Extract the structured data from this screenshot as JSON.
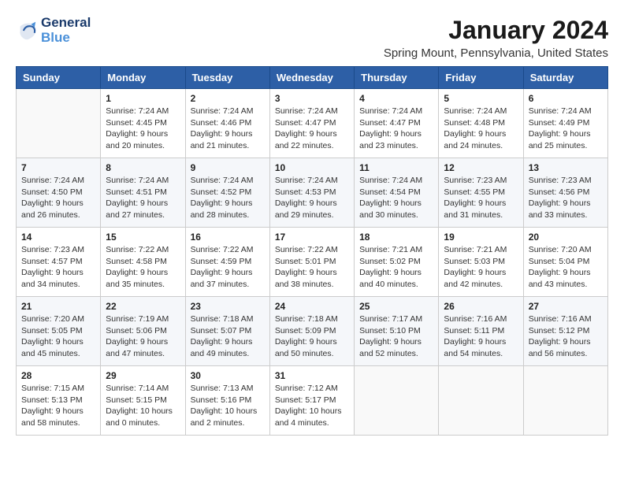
{
  "logo": {
    "line1": "General",
    "line2": "Blue"
  },
  "title": "January 2024",
  "location": "Spring Mount, Pennsylvania, United States",
  "days_of_week": [
    "Sunday",
    "Monday",
    "Tuesday",
    "Wednesday",
    "Thursday",
    "Friday",
    "Saturday"
  ],
  "weeks": [
    [
      {
        "day": "",
        "info": ""
      },
      {
        "day": "1",
        "info": "Sunrise: 7:24 AM\nSunset: 4:45 PM\nDaylight: 9 hours\nand 20 minutes."
      },
      {
        "day": "2",
        "info": "Sunrise: 7:24 AM\nSunset: 4:46 PM\nDaylight: 9 hours\nand 21 minutes."
      },
      {
        "day": "3",
        "info": "Sunrise: 7:24 AM\nSunset: 4:47 PM\nDaylight: 9 hours\nand 22 minutes."
      },
      {
        "day": "4",
        "info": "Sunrise: 7:24 AM\nSunset: 4:47 PM\nDaylight: 9 hours\nand 23 minutes."
      },
      {
        "day": "5",
        "info": "Sunrise: 7:24 AM\nSunset: 4:48 PM\nDaylight: 9 hours\nand 24 minutes."
      },
      {
        "day": "6",
        "info": "Sunrise: 7:24 AM\nSunset: 4:49 PM\nDaylight: 9 hours\nand 25 minutes."
      }
    ],
    [
      {
        "day": "7",
        "info": "Sunrise: 7:24 AM\nSunset: 4:50 PM\nDaylight: 9 hours\nand 26 minutes."
      },
      {
        "day": "8",
        "info": "Sunrise: 7:24 AM\nSunset: 4:51 PM\nDaylight: 9 hours\nand 27 minutes."
      },
      {
        "day": "9",
        "info": "Sunrise: 7:24 AM\nSunset: 4:52 PM\nDaylight: 9 hours\nand 28 minutes."
      },
      {
        "day": "10",
        "info": "Sunrise: 7:24 AM\nSunset: 4:53 PM\nDaylight: 9 hours\nand 29 minutes."
      },
      {
        "day": "11",
        "info": "Sunrise: 7:24 AM\nSunset: 4:54 PM\nDaylight: 9 hours\nand 30 minutes."
      },
      {
        "day": "12",
        "info": "Sunrise: 7:23 AM\nSunset: 4:55 PM\nDaylight: 9 hours\nand 31 minutes."
      },
      {
        "day": "13",
        "info": "Sunrise: 7:23 AM\nSunset: 4:56 PM\nDaylight: 9 hours\nand 33 minutes."
      }
    ],
    [
      {
        "day": "14",
        "info": "Sunrise: 7:23 AM\nSunset: 4:57 PM\nDaylight: 9 hours\nand 34 minutes."
      },
      {
        "day": "15",
        "info": "Sunrise: 7:22 AM\nSunset: 4:58 PM\nDaylight: 9 hours\nand 35 minutes."
      },
      {
        "day": "16",
        "info": "Sunrise: 7:22 AM\nSunset: 4:59 PM\nDaylight: 9 hours\nand 37 minutes."
      },
      {
        "day": "17",
        "info": "Sunrise: 7:22 AM\nSunset: 5:01 PM\nDaylight: 9 hours\nand 38 minutes."
      },
      {
        "day": "18",
        "info": "Sunrise: 7:21 AM\nSunset: 5:02 PM\nDaylight: 9 hours\nand 40 minutes."
      },
      {
        "day": "19",
        "info": "Sunrise: 7:21 AM\nSunset: 5:03 PM\nDaylight: 9 hours\nand 42 minutes."
      },
      {
        "day": "20",
        "info": "Sunrise: 7:20 AM\nSunset: 5:04 PM\nDaylight: 9 hours\nand 43 minutes."
      }
    ],
    [
      {
        "day": "21",
        "info": "Sunrise: 7:20 AM\nSunset: 5:05 PM\nDaylight: 9 hours\nand 45 minutes."
      },
      {
        "day": "22",
        "info": "Sunrise: 7:19 AM\nSunset: 5:06 PM\nDaylight: 9 hours\nand 47 minutes."
      },
      {
        "day": "23",
        "info": "Sunrise: 7:18 AM\nSunset: 5:07 PM\nDaylight: 9 hours\nand 49 minutes."
      },
      {
        "day": "24",
        "info": "Sunrise: 7:18 AM\nSunset: 5:09 PM\nDaylight: 9 hours\nand 50 minutes."
      },
      {
        "day": "25",
        "info": "Sunrise: 7:17 AM\nSunset: 5:10 PM\nDaylight: 9 hours\nand 52 minutes."
      },
      {
        "day": "26",
        "info": "Sunrise: 7:16 AM\nSunset: 5:11 PM\nDaylight: 9 hours\nand 54 minutes."
      },
      {
        "day": "27",
        "info": "Sunrise: 7:16 AM\nSunset: 5:12 PM\nDaylight: 9 hours\nand 56 minutes."
      }
    ],
    [
      {
        "day": "28",
        "info": "Sunrise: 7:15 AM\nSunset: 5:13 PM\nDaylight: 9 hours\nand 58 minutes."
      },
      {
        "day": "29",
        "info": "Sunrise: 7:14 AM\nSunset: 5:15 PM\nDaylight: 10 hours\nand 0 minutes."
      },
      {
        "day": "30",
        "info": "Sunrise: 7:13 AM\nSunset: 5:16 PM\nDaylight: 10 hours\nand 2 minutes."
      },
      {
        "day": "31",
        "info": "Sunrise: 7:12 AM\nSunset: 5:17 PM\nDaylight: 10 hours\nand 4 minutes."
      },
      {
        "day": "",
        "info": ""
      },
      {
        "day": "",
        "info": ""
      },
      {
        "day": "",
        "info": ""
      }
    ]
  ]
}
